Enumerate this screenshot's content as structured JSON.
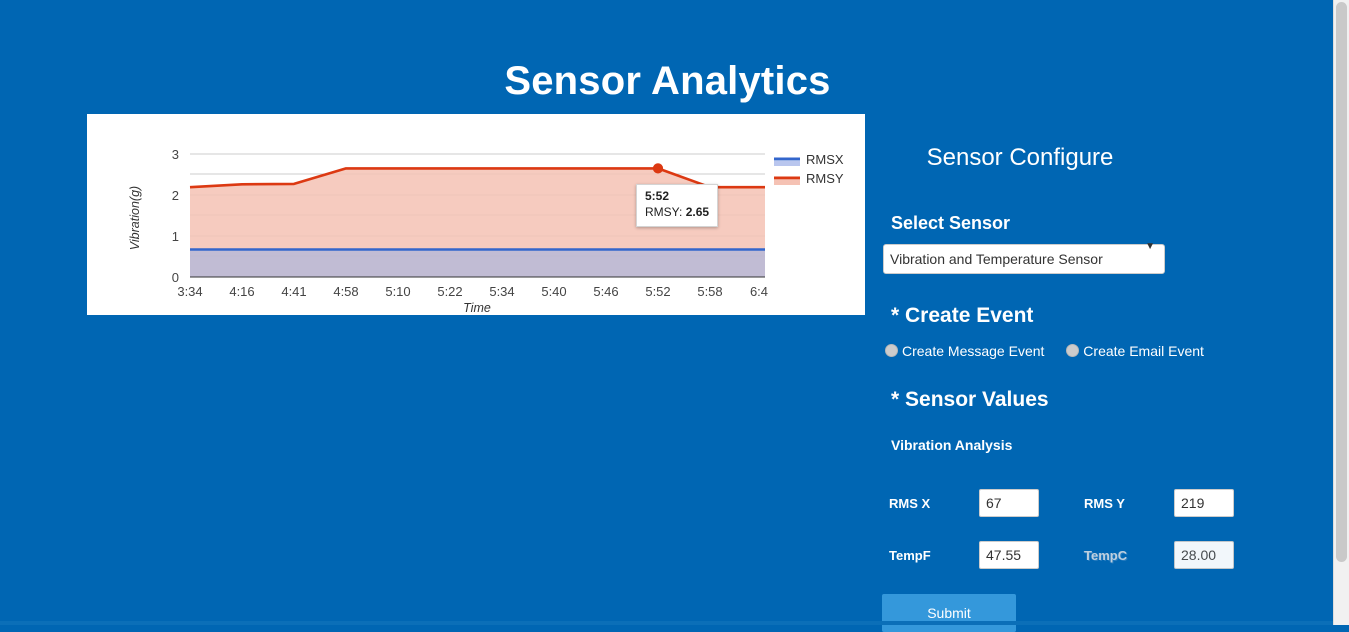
{
  "header": {
    "title": "Sensor Analytics"
  },
  "chart_data": {
    "type": "area",
    "title": "",
    "xlabel": "Time",
    "ylabel": "Vibration(g)",
    "categories": [
      "3:34",
      "4:16",
      "4:41",
      "4:58",
      "5:10",
      "5:22",
      "5:34",
      "5:40",
      "5:46",
      "5:52",
      "5:58",
      "6:4"
    ],
    "ylim": [
      0,
      3
    ],
    "yticks": [
      0,
      1,
      2,
      3
    ],
    "grid": true,
    "legend_position": "right",
    "series": [
      {
        "name": "RMSX",
        "color": "#3366cc",
        "fill": "#b9c6ee",
        "values": [
          0.67,
          0.67,
          0.67,
          0.67,
          0.67,
          0.67,
          0.67,
          0.67,
          0.67,
          0.67,
          0.67,
          0.67
        ]
      },
      {
        "name": "RMSY",
        "color": "#dc3912",
        "fill": "#f5c2b4",
        "values": [
          2.19,
          2.26,
          2.27,
          2.65,
          2.65,
          2.65,
          2.65,
          2.65,
          2.65,
          2.65,
          2.19,
          2.19
        ]
      }
    ],
    "tooltip": {
      "time": "5:52",
      "series_label": "RMSY:",
      "value": "2.65"
    }
  },
  "config": {
    "title": "Sensor Configure",
    "select_sensor_label": "Select Sensor",
    "sensor_select": {
      "selected": "Vibration and Temperature Sensor",
      "options": [
        "Vibration and Temperature Sensor"
      ],
      "caret": "▼"
    },
    "create_event_heading": "* Create Event",
    "radios": [
      {
        "label": "Create Message Event",
        "selected": false
      },
      {
        "label": "Create Email Event",
        "selected": false
      }
    ],
    "sensor_values_heading": "* Sensor Values",
    "vibration_analysis_label": "Vibration Analysis",
    "fields": [
      [
        {
          "label": "RMS X",
          "value": "67"
        },
        {
          "label": "RMS Y",
          "value": "219"
        }
      ],
      [
        {
          "label": "TempF",
          "value": "47.55"
        },
        {
          "label": "TempC",
          "value": "28.00"
        }
      ]
    ],
    "submit_label": "Submit"
  },
  "colors": {
    "page_background": "#0066b3",
    "card_background": "#ffffff",
    "submit_button": "#3498db",
    "rmsx_line": "#3366cc",
    "rmsy_line": "#dc3912"
  }
}
